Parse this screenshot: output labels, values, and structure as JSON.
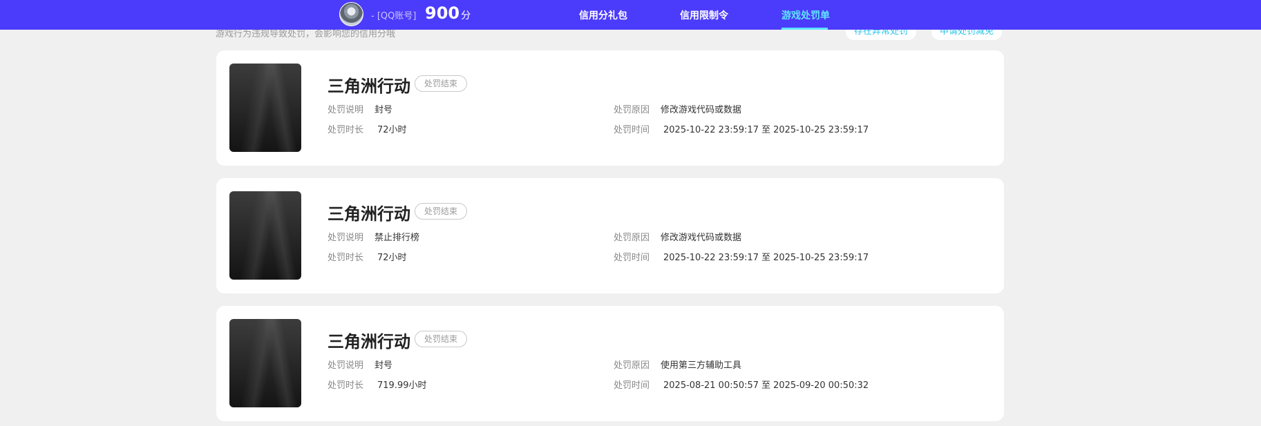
{
  "header": {
    "account_label": "- [QQ账号]",
    "score": "900",
    "score_unit": "分",
    "tabs": [
      {
        "label": "信用分礼包",
        "active": false
      },
      {
        "label": "信用限制令",
        "active": false
      },
      {
        "label": "游戏处罚单",
        "active": true
      }
    ]
  },
  "subheader": {
    "text": "游戏行为违规导致处罚，会影响您的信用分哦",
    "buttons": [
      {
        "label": "存在异常处罚"
      },
      {
        "label": "申请处罚减免"
      }
    ]
  },
  "labels": {
    "desc": "处罚说明",
    "duration": "处罚时长",
    "reason": "处罚原因",
    "time": "处罚时间",
    "time_sep": "至"
  },
  "penalties": [
    {
      "game": "三角洲行动",
      "status": "处罚结束",
      "desc": "封号",
      "duration": "72小时",
      "reason": "修改游戏代码或数据",
      "start": "2025-10-22 23:59:17",
      "end": "2025-10-25 23:59:17"
    },
    {
      "game": "三角洲行动",
      "status": "处罚结束",
      "desc": "禁止排行榜",
      "duration": "72小时",
      "reason": "修改游戏代码或数据",
      "start": "2025-10-22 23:59:17",
      "end": "2025-10-25 23:59:17"
    },
    {
      "game": "三角洲行动",
      "status": "处罚结束",
      "desc": "封号",
      "duration": "719.99小时",
      "reason": "使用第三方辅助工具",
      "start": "2025-08-21 00:50:57",
      "end": "2025-09-20 00:50:32"
    }
  ],
  "colors": {
    "topbar": "#4b3bfa",
    "active_tab": "#5ee4ff",
    "page_bg": "#f0f0f0"
  }
}
